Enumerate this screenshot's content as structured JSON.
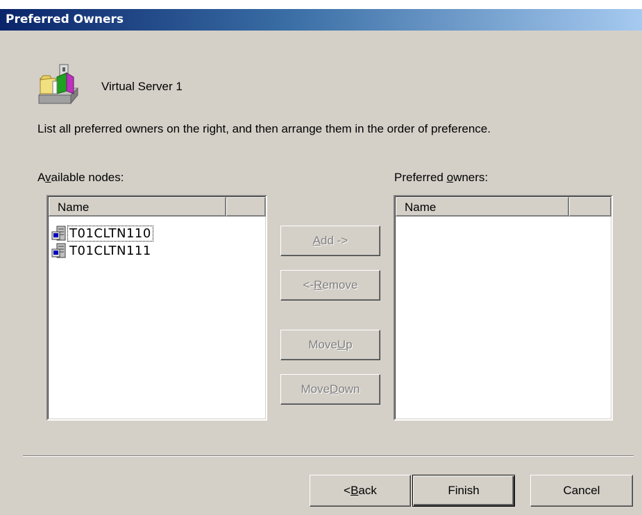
{
  "dialog": {
    "title": "Preferred Owners",
    "server_name": "Virtual Server 1",
    "instructions": "List all preferred owners on the right, and then arrange them in the order of preference."
  },
  "available": {
    "label_pre": "A",
    "label_accel": "v",
    "label_post": "ailable nodes:",
    "column_name": "Name",
    "items": [
      {
        "label": "T01CLTN110",
        "icon": "cluster-node-icon",
        "focused": true
      },
      {
        "label": "T01CLTN111",
        "icon": "cluster-node-icon",
        "focused": false
      }
    ]
  },
  "preferred": {
    "label_pre": "Preferred ",
    "label_accel": "o",
    "label_post": "wners:",
    "column_name": "Name",
    "items": []
  },
  "buttons": {
    "add": {
      "pre": "",
      "accel": "A",
      "post": "dd ->",
      "enabled": false
    },
    "remove": {
      "pre": "<- ",
      "accel": "R",
      "post": "emove",
      "enabled": false
    },
    "move_up": {
      "pre": "Move ",
      "accel": "U",
      "post": "p",
      "enabled": false
    },
    "move_down": {
      "pre": "Move ",
      "accel": "D",
      "post": "own",
      "enabled": false
    },
    "back": {
      "pre": "< ",
      "accel": "B",
      "post": "ack",
      "enabled": true
    },
    "finish": {
      "label": "Finish",
      "enabled": true
    },
    "cancel": {
      "label": "Cancel",
      "enabled": true
    }
  },
  "icons": {
    "server_icon": "virtual-server-icon",
    "node_icon": "cluster-node-icon"
  },
  "colors": {
    "title_start": "#0a246a",
    "title_end": "#a6caf0",
    "face": "#d4d0c8"
  }
}
